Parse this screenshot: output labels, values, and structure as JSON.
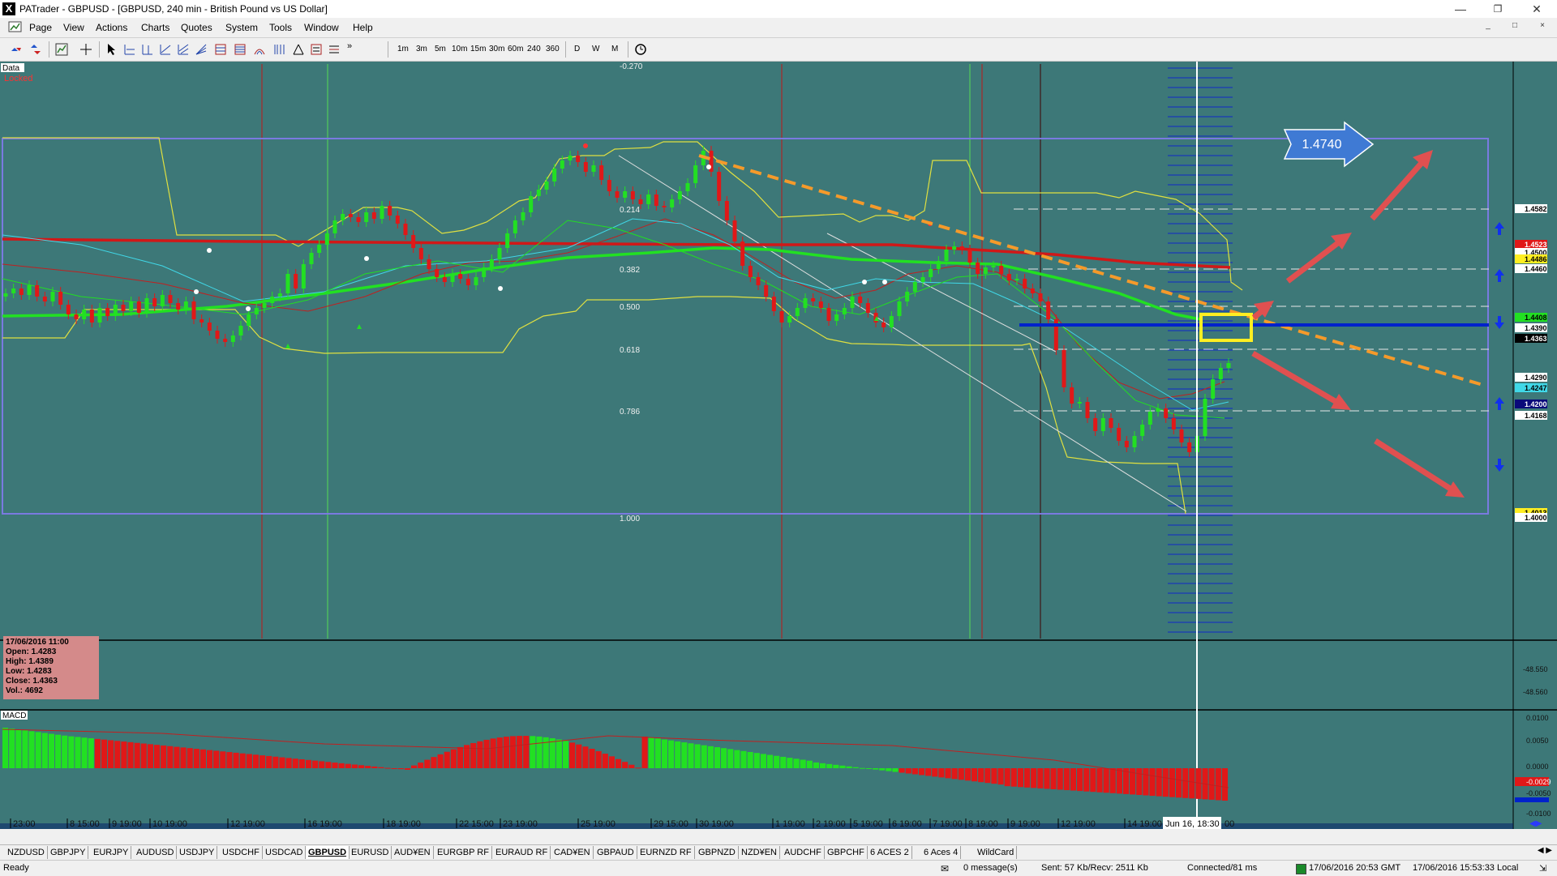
{
  "window": {
    "title": "PATrader - GBPUSD - [GBPUSD, 240 min - British Pound vs US Dollar]",
    "logo": "X"
  },
  "menu": [
    "Page",
    "View",
    "Actions",
    "Charts",
    "Quotes",
    "System",
    "Tools",
    "Window",
    "Help"
  ],
  "toolbar": {
    "timeframes": [
      "1m",
      "3m",
      "5m",
      "10m",
      "15m",
      "30m",
      "60m",
      "240",
      "360",
      "D",
      "W",
      "M"
    ],
    "overflow": "»"
  },
  "chart": {
    "data_label": "Data",
    "locked_label": "Locked",
    "macd_label": "MACD",
    "fib_levels": [
      "-0.270",
      "0.214",
      "0.382",
      "0.500",
      "0.618",
      "0.786",
      "1.000"
    ],
    "target_label": "1.4740",
    "price_labels": [
      "1.4582",
      "1.4523",
      "1.4500",
      "1.4486",
      "1.4460",
      "1.4408",
      "1.4390",
      "1.4363",
      "1.4290",
      "1.4247",
      "1.4200",
      "1.4168",
      "1.4013",
      "1.4000"
    ],
    "ind_labels": [
      "-48.550",
      "-48.560"
    ],
    "macd_labels": [
      "0.0100",
      "0.0050",
      "0.0000",
      "-0.0029",
      "-0.0050",
      "-0.0100"
    ],
    "date_labels": [
      "23:00",
      "8 15:00",
      "9 19:00",
      "10 19:00",
      "12 19:00",
      "16 19:00",
      "18 19:00",
      "22 15:00",
      "23 19:00",
      "25 19:00",
      "29 15:00",
      "30 19:00",
      "1 19:00",
      "2 19:00",
      "5 19:00",
      "6 19:00",
      "7 19:00",
      "8 19:00",
      "9 19:00",
      "12 19:00",
      "14 19:00",
      "Jun 16, 18:30",
      "00"
    ],
    "colors": {
      "background": "#3d7878",
      "bull": "#22e022",
      "bear": "#e01818",
      "fib_box": "#7a7ae0",
      "trendline": "#f59a2a",
      "support": "#0022cc",
      "highlight": "#ffee22",
      "arrow": "#e05050",
      "callout": "#3f7ad4"
    }
  },
  "info": {
    "date": "17/06/2016 11:00",
    "open": "Open: 1.4283",
    "high": "High: 1.4389",
    "low": "Low: 1.4283",
    "close": "Close: 1.4363",
    "vol": "Vol.: 4692"
  },
  "tabs": [
    "NZDUSD",
    "GBPJPY",
    "EURJPY",
    "AUDUSD",
    "USDJPY",
    "USDCHF",
    "USDCAD",
    "GBPUSD",
    "EURUSD",
    "AUD¥EN",
    "EURGBP RF",
    "EURAUD RF",
    "CAD¥EN",
    "GBPAUD",
    "EURNZD RF",
    "GBPNZD",
    "NZD¥EN",
    "AUDCHF",
    "GBPCHF",
    "6 ACES 2",
    "6 Aces 4",
    "WildCard"
  ],
  "active_tab": "GBPUSD",
  "status": {
    "ready": "Ready",
    "messages": "0 message(s)",
    "traffic": "Sent: 57 Kb/Recv: 2511 Kb",
    "connection": "Connected/81 ms",
    "gmt": "17/06/2016 20:53 GMT",
    "local": "17/06/2016 15:53:33 Local"
  }
}
